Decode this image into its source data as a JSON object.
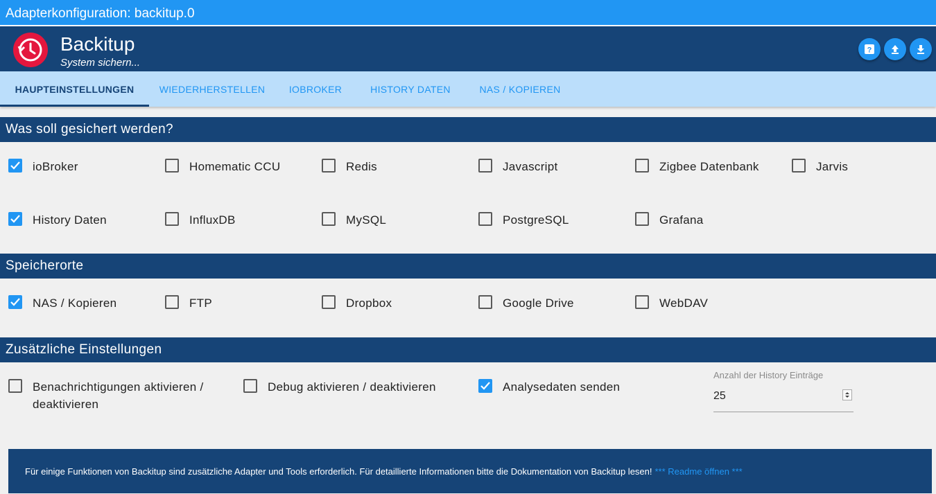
{
  "window": {
    "title": "Adapterkonfiguration: backitup.0"
  },
  "header": {
    "app_name": "Backitup",
    "subtitle": "System sichern...",
    "buttons": [
      "help-icon",
      "upload-icon",
      "download-icon"
    ]
  },
  "tabs": [
    {
      "label": "HAUPTEINSTELLUNGEN",
      "active": true
    },
    {
      "label": "WIEDERHERSTELLEN",
      "active": false
    },
    {
      "label": "IOBROKER",
      "active": false
    },
    {
      "label": "HISTORY DATEN",
      "active": false
    },
    {
      "label": "NAS / KOPIEREN",
      "active": false
    }
  ],
  "sections": {
    "backup": {
      "title": "Was soll gesichert werden?",
      "items": [
        {
          "label": "ioBroker",
          "checked": true
        },
        {
          "label": "Homematic CCU",
          "checked": false
        },
        {
          "label": "Redis",
          "checked": false
        },
        {
          "label": "Javascript",
          "checked": false
        },
        {
          "label": "Zigbee Datenbank",
          "checked": false
        },
        {
          "label": "Jarvis",
          "checked": false
        },
        {
          "label": "History Daten",
          "checked": true
        },
        {
          "label": "InfluxDB",
          "checked": false
        },
        {
          "label": "MySQL",
          "checked": false
        },
        {
          "label": "PostgreSQL",
          "checked": false
        },
        {
          "label": "Grafana",
          "checked": false
        }
      ]
    },
    "storage": {
      "title": "Speicherorte",
      "items": [
        {
          "label": "NAS / Kopieren",
          "checked": true
        },
        {
          "label": "FTP",
          "checked": false
        },
        {
          "label": "Dropbox",
          "checked": false
        },
        {
          "label": "Google Drive",
          "checked": false
        },
        {
          "label": "WebDAV",
          "checked": false
        }
      ]
    },
    "extra": {
      "title": "Zusätzliche Einstellungen",
      "items": [
        {
          "label": "Benachrichtigungen aktivieren / deaktivieren",
          "checked": false
        },
        {
          "label": "Debug aktivieren / deaktivieren",
          "checked": false
        },
        {
          "label": "Analysedaten senden",
          "checked": true
        }
      ],
      "history_count": {
        "label": "Anzahl der History Einträge",
        "value": "25"
      }
    }
  },
  "info": {
    "text": "Für einige Funktionen von Backitup sind zusätzliche Adapter und Tools erforderlich. Für detaillierte Informationen bitte die Dokumentation von Backitup lesen!",
    "link": "*** Readme öffnen ***"
  },
  "colors": {
    "primary": "#2196f3",
    "dark": "#164477",
    "tab_bg": "#bbdefb",
    "logo": "#e4173e"
  }
}
